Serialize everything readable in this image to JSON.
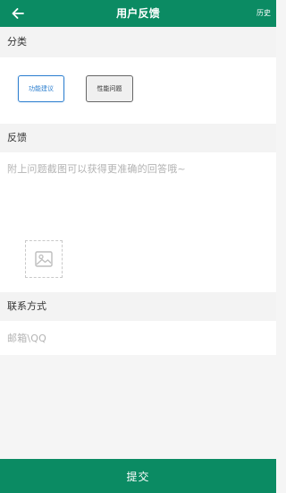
{
  "header": {
    "title": "用户反馈",
    "history_label": "历史",
    "back_icon": "arrow-left-icon"
  },
  "category": {
    "label": "分类",
    "options": [
      {
        "label": "功能建议",
        "selected": true
      },
      {
        "label": "性能问题",
        "selected": false
      }
    ]
  },
  "feedback": {
    "label": "反馈",
    "placeholder": "附上问题截图可以获得更准确的回答哦~",
    "add_image_icon": "image-icon"
  },
  "contact": {
    "label": "联系方式",
    "placeholder": "邮箱\\QQ"
  },
  "submit": {
    "label": "提交"
  },
  "colors": {
    "brand": "#0b8b63",
    "selected_chip": "#2f80d0"
  }
}
